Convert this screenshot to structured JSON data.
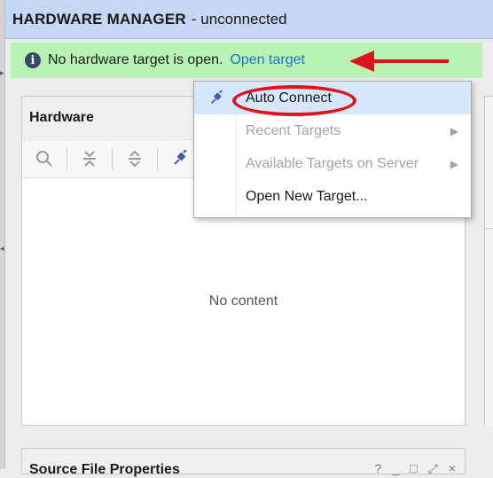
{
  "title_bar": {
    "title": "HARDWARE MANAGER",
    "subtitle": "- unconnected"
  },
  "banner": {
    "message": "No hardware target is open.",
    "link_text": "Open target",
    "icon": "info-icon"
  },
  "hardware_panel": {
    "title": "Hardware",
    "toolbar": [
      {
        "name": "search-icon"
      },
      {
        "name": "collapse-all-icon"
      },
      {
        "name": "expand-all-icon"
      },
      {
        "name": "auto-connect-icon"
      }
    ],
    "empty_text": "No content"
  },
  "source_file_properties": {
    "title": "Source File Properties",
    "tools": [
      "?",
      "_",
      "□",
      "⤢",
      "×"
    ]
  },
  "context_menu": {
    "items": [
      {
        "label": "Auto Connect",
        "enabled": true,
        "icon": "auto-connect-icon",
        "submenu": false
      },
      {
        "label": "Recent Targets",
        "enabled": false,
        "submenu": true
      },
      {
        "label": "Available Targets on Server",
        "enabled": false,
        "submenu": true
      },
      {
        "label": "Open New Target...",
        "enabled": true,
        "submenu": false
      }
    ]
  },
  "colors": {
    "title_bar": "#c6d6f3",
    "banner": "#b9f3b4",
    "link": "#1f6fd1",
    "annotation": "#e0131a"
  }
}
